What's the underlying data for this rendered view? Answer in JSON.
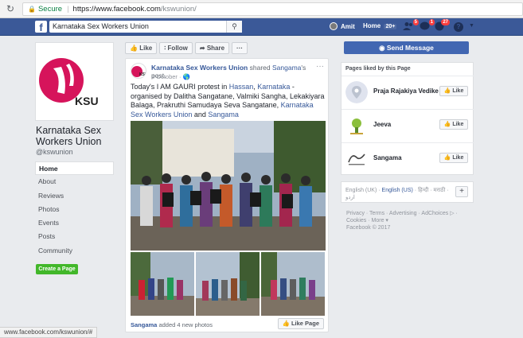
{
  "browser": {
    "secure_label": "Secure",
    "url_host": "https://www.facebook.com",
    "url_path": "/kswunion/"
  },
  "topbar": {
    "search_value": "Karnataka Sex Workers Union",
    "user_name": "Amit",
    "home_label": "Home",
    "home_count": "20+",
    "friends_badge": "5",
    "messages_badge": "1",
    "notifications_badge": "27"
  },
  "page": {
    "name": "Karnataka Sex Workers Union",
    "handle": "@kswunion",
    "logo_text": "KSU"
  },
  "left_nav": {
    "items": [
      "Home",
      "About",
      "Reviews",
      "Photos",
      "Events",
      "Posts",
      "Community"
    ],
    "create_page": "Create a Page"
  },
  "actions": {
    "like": "Like",
    "follow": "Follow",
    "share": "Share",
    "more": "···"
  },
  "post": {
    "author": "Karnataka Sex Workers Union",
    "shared_text": "shared",
    "shared_from": "Sangama",
    "shared_suffix": "'s post.",
    "date": "2 October ·",
    "text_1": "Today's I AM GAURI protest in ",
    "link_hassan": "Hassan",
    "text_comma": ", ",
    "link_karnataka": "Karnataka",
    "text_2": " - organised by Dalitha Sangatane, Valmiki Sangha, Lekakiyara Balaga, Prakruthi Samudaya Seva Sangatane, ",
    "link_ksu": "Karnataka Sex Workers Union",
    "text_and": " and ",
    "link_sangama": "Sangama",
    "footer_author": "Sangama",
    "footer_text": "added 4 new photos",
    "like_page": "Like Page"
  },
  "right": {
    "send_message": "Send Message",
    "liked_title": "Pages liked by this Page",
    "liked_pages": [
      {
        "name": "Praja Rajakiya Vedike",
        "button": "Like"
      },
      {
        "name": "Jeeva",
        "button": "Like"
      },
      {
        "name": "Sangama",
        "button": "Like"
      }
    ],
    "lang_uk": "English (UK)",
    "lang_us": "English (US)",
    "lang_hi": "हिन्दी",
    "lang_mr": "मराठी",
    "lang_ur": "اردو",
    "lang_plus": "+",
    "footer_line1": "Privacy · Terms · Advertising · AdChoices ▷ ·",
    "footer_line2": "Cookies · More ▾",
    "footer_line3": "Facebook © 2017"
  },
  "status_bar": "www.facebook.com/kswunion/#",
  "colors": {
    "fb_blue": "#3b5998",
    "link": "#365899",
    "logo_pink": "#d6145b",
    "create_green": "#42b72a"
  }
}
